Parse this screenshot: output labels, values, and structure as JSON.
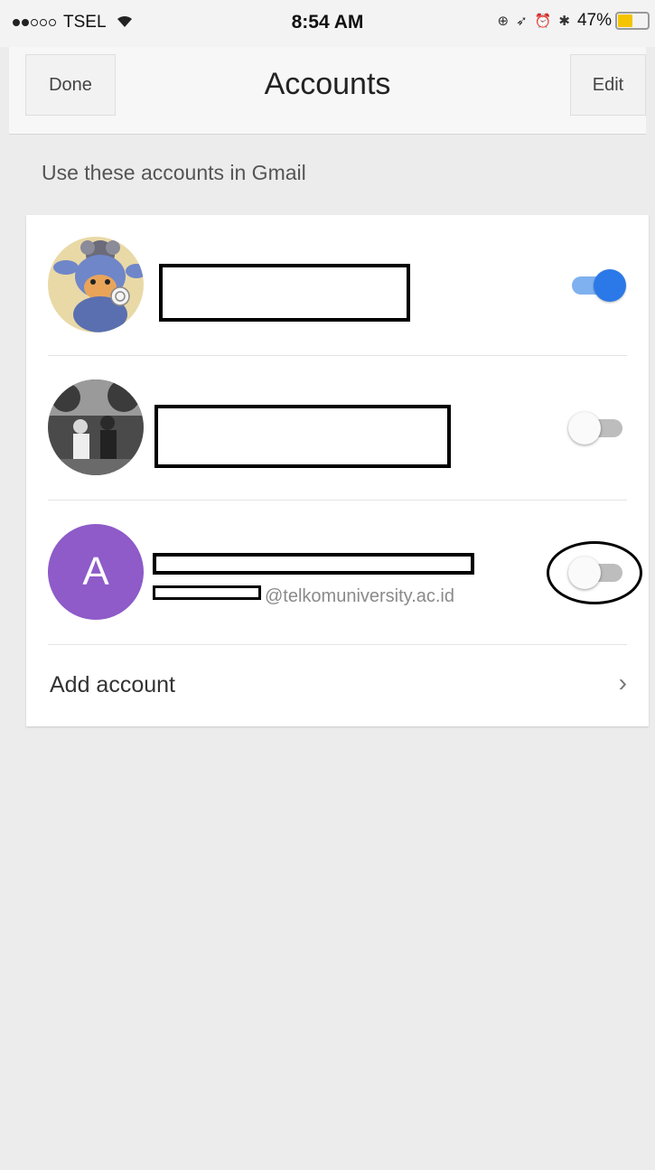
{
  "status_bar": {
    "carrier": "TSEL",
    "time": "8:54 AM",
    "battery_percent": "47%",
    "battery_level": 0.47,
    "signal_bars": 2,
    "icons": [
      "wifi-icon",
      "lock-rotation-icon",
      "location-icon",
      "alarm-icon",
      "bluetooth-icon",
      "battery-icon"
    ]
  },
  "nav": {
    "done_label": "Done",
    "title": "Accounts",
    "edit_label": "Edit"
  },
  "section_header": "Use these accounts in Gmail",
  "accounts": [
    {
      "avatar": "photo-avatar-plush-toy",
      "name": "",
      "email": "",
      "enabled": true
    },
    {
      "avatar": "photo-avatar-people",
      "name": "",
      "email": "",
      "enabled": false
    },
    {
      "avatar_letter": "A",
      "name": "",
      "email": "@telkomuniversity.ac.id",
      "enabled": false
    }
  ],
  "add_account": {
    "label": "Add account",
    "chevron": "›"
  },
  "colors": {
    "accent": "#2b79e8",
    "letter_avatar": "#8e5bc9",
    "background": "#ececec"
  }
}
